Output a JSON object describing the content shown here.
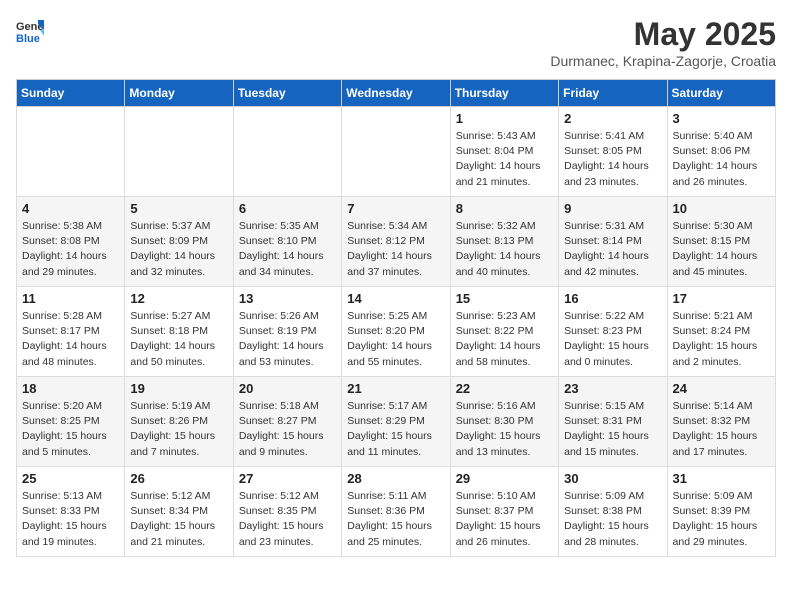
{
  "header": {
    "logo_general": "General",
    "logo_blue": "Blue",
    "title": "May 2025",
    "subtitle": "Durmanec, Krapina-Zagorje, Croatia"
  },
  "weekdays": [
    "Sunday",
    "Monday",
    "Tuesday",
    "Wednesday",
    "Thursday",
    "Friday",
    "Saturday"
  ],
  "weeks": [
    [
      {
        "day": "",
        "info": ""
      },
      {
        "day": "",
        "info": ""
      },
      {
        "day": "",
        "info": ""
      },
      {
        "day": "",
        "info": ""
      },
      {
        "day": "1",
        "info": "Sunrise: 5:43 AM\nSunset: 8:04 PM\nDaylight: 14 hours\nand 21 minutes."
      },
      {
        "day": "2",
        "info": "Sunrise: 5:41 AM\nSunset: 8:05 PM\nDaylight: 14 hours\nand 23 minutes."
      },
      {
        "day": "3",
        "info": "Sunrise: 5:40 AM\nSunset: 8:06 PM\nDaylight: 14 hours\nand 26 minutes."
      }
    ],
    [
      {
        "day": "4",
        "info": "Sunrise: 5:38 AM\nSunset: 8:08 PM\nDaylight: 14 hours\nand 29 minutes."
      },
      {
        "day": "5",
        "info": "Sunrise: 5:37 AM\nSunset: 8:09 PM\nDaylight: 14 hours\nand 32 minutes."
      },
      {
        "day": "6",
        "info": "Sunrise: 5:35 AM\nSunset: 8:10 PM\nDaylight: 14 hours\nand 34 minutes."
      },
      {
        "day": "7",
        "info": "Sunrise: 5:34 AM\nSunset: 8:12 PM\nDaylight: 14 hours\nand 37 minutes."
      },
      {
        "day": "8",
        "info": "Sunrise: 5:32 AM\nSunset: 8:13 PM\nDaylight: 14 hours\nand 40 minutes."
      },
      {
        "day": "9",
        "info": "Sunrise: 5:31 AM\nSunset: 8:14 PM\nDaylight: 14 hours\nand 42 minutes."
      },
      {
        "day": "10",
        "info": "Sunrise: 5:30 AM\nSunset: 8:15 PM\nDaylight: 14 hours\nand 45 minutes."
      }
    ],
    [
      {
        "day": "11",
        "info": "Sunrise: 5:28 AM\nSunset: 8:17 PM\nDaylight: 14 hours\nand 48 minutes."
      },
      {
        "day": "12",
        "info": "Sunrise: 5:27 AM\nSunset: 8:18 PM\nDaylight: 14 hours\nand 50 minutes."
      },
      {
        "day": "13",
        "info": "Sunrise: 5:26 AM\nSunset: 8:19 PM\nDaylight: 14 hours\nand 53 minutes."
      },
      {
        "day": "14",
        "info": "Sunrise: 5:25 AM\nSunset: 8:20 PM\nDaylight: 14 hours\nand 55 minutes."
      },
      {
        "day": "15",
        "info": "Sunrise: 5:23 AM\nSunset: 8:22 PM\nDaylight: 14 hours\nand 58 minutes."
      },
      {
        "day": "16",
        "info": "Sunrise: 5:22 AM\nSunset: 8:23 PM\nDaylight: 15 hours\nand 0 minutes."
      },
      {
        "day": "17",
        "info": "Sunrise: 5:21 AM\nSunset: 8:24 PM\nDaylight: 15 hours\nand 2 minutes."
      }
    ],
    [
      {
        "day": "18",
        "info": "Sunrise: 5:20 AM\nSunset: 8:25 PM\nDaylight: 15 hours\nand 5 minutes."
      },
      {
        "day": "19",
        "info": "Sunrise: 5:19 AM\nSunset: 8:26 PM\nDaylight: 15 hours\nand 7 minutes."
      },
      {
        "day": "20",
        "info": "Sunrise: 5:18 AM\nSunset: 8:27 PM\nDaylight: 15 hours\nand 9 minutes."
      },
      {
        "day": "21",
        "info": "Sunrise: 5:17 AM\nSunset: 8:29 PM\nDaylight: 15 hours\nand 11 minutes."
      },
      {
        "day": "22",
        "info": "Sunrise: 5:16 AM\nSunset: 8:30 PM\nDaylight: 15 hours\nand 13 minutes."
      },
      {
        "day": "23",
        "info": "Sunrise: 5:15 AM\nSunset: 8:31 PM\nDaylight: 15 hours\nand 15 minutes."
      },
      {
        "day": "24",
        "info": "Sunrise: 5:14 AM\nSunset: 8:32 PM\nDaylight: 15 hours\nand 17 minutes."
      }
    ],
    [
      {
        "day": "25",
        "info": "Sunrise: 5:13 AM\nSunset: 8:33 PM\nDaylight: 15 hours\nand 19 minutes."
      },
      {
        "day": "26",
        "info": "Sunrise: 5:12 AM\nSunset: 8:34 PM\nDaylight: 15 hours\nand 21 minutes."
      },
      {
        "day": "27",
        "info": "Sunrise: 5:12 AM\nSunset: 8:35 PM\nDaylight: 15 hours\nand 23 minutes."
      },
      {
        "day": "28",
        "info": "Sunrise: 5:11 AM\nSunset: 8:36 PM\nDaylight: 15 hours\nand 25 minutes."
      },
      {
        "day": "29",
        "info": "Sunrise: 5:10 AM\nSunset: 8:37 PM\nDaylight: 15 hours\nand 26 minutes."
      },
      {
        "day": "30",
        "info": "Sunrise: 5:09 AM\nSunset: 8:38 PM\nDaylight: 15 hours\nand 28 minutes."
      },
      {
        "day": "31",
        "info": "Sunrise: 5:09 AM\nSunset: 8:39 PM\nDaylight: 15 hours\nand 29 minutes."
      }
    ]
  ]
}
